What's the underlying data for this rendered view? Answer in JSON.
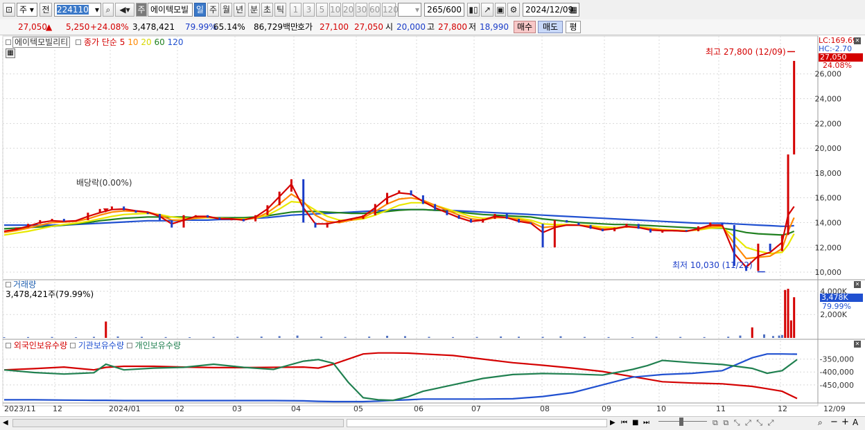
{
  "toolbar": {
    "market_select": "주",
    "prev_label": "전",
    "stock_code": "224110",
    "stock_name": "에이텍모빌",
    "code_badge": "주",
    "periods": [
      "일",
      "주",
      "월",
      "년",
      "분",
      "초",
      "틱"
    ],
    "selected_period": "일",
    "intervals": [
      "1",
      "3",
      "5",
      "10",
      "20",
      "30",
      "60",
      "120"
    ],
    "count_current": "265",
    "count_total": "/600",
    "date": "2024/12/09"
  },
  "info": {
    "price": "27,050",
    "up_arrow": "▲",
    "change": "5,250",
    "change_pct": "+24.08%",
    "volume": "3,478,421",
    "vol_ratio": "79.99%",
    "turnover": "65.14%",
    "amount": "86,729백만",
    "quote_label": "호가",
    "ask": "27,100",
    "bid": "27,050",
    "open_label": "시",
    "open": "20,000",
    "high_label": "고",
    "high": "27,800",
    "low_label": "저",
    "low": "18,990",
    "buy_label": "매수",
    "sell_label": "매도",
    "avg_label": "평"
  },
  "price_panel": {
    "legend_name": "에이텍모빌리티",
    "legend_ma_label": "종가 단순",
    "ma_periods": [
      "5",
      "10",
      "20",
      "60",
      "120"
    ],
    "ma_colors": [
      "#d40000",
      "#ff8800",
      "#e8e800",
      "#208020",
      "#2050d0"
    ],
    "lc_label": "LC:169.69",
    "hc_label": "HC:-2.70",
    "current_price_badge": "27,050",
    "pct_badge": "24.08%",
    "high_annotation": "최고 27,800 (12/09)",
    "low_annotation": "최저 10,030 (11/22)",
    "dividend_label": "배당락(0.00%)"
  },
  "volume_panel": {
    "title": "거래량",
    "value_label": "3,478,421주(79.99%)",
    "current_badge": "3,478K",
    "pct_badge": "79.99%"
  },
  "holdings_panel": {
    "legend": [
      {
        "name": "외국인보유수량",
        "color": "#d40000"
      },
      {
        "name": "기관보유수량",
        "color": "#2050d0"
      },
      {
        "name": "개인보유수량",
        "color": "#208050"
      }
    ]
  },
  "xaxis": {
    "labels": [
      "2023/11",
      "12",
      "2024/01",
      "02",
      "03",
      "04",
      "05",
      "06",
      "07",
      "08",
      "09",
      "10",
      "11",
      "12",
      "12/09"
    ]
  },
  "chart_data": [
    {
      "type": "line",
      "name": "price",
      "ylim": [
        9500,
        28500
      ],
      "y_ticks": [
        "10,000",
        "12,000",
        "14,000",
        "16,000",
        "18,000",
        "20,000",
        "22,000",
        "24,000",
        "26,000"
      ],
      "y_tick_values": [
        10000,
        12000,
        14000,
        16000,
        18000,
        20000,
        22000,
        24000,
        26000
      ],
      "x": [
        0,
        4,
        8,
        12,
        16,
        20,
        24,
        28,
        32,
        36,
        40,
        44,
        48,
        52,
        56,
        60,
        64,
        68,
        72,
        76,
        80,
        84,
        88,
        92,
        96,
        100,
        104,
        108,
        112,
        116,
        120,
        124,
        128,
        132,
        136,
        140,
        144,
        148,
        152,
        156,
        160,
        164,
        168,
        172,
        176,
        180,
        184,
        188,
        192,
        196,
        200,
        204,
        208,
        212,
        216,
        220,
        224,
        228,
        232,
        236,
        240,
        244,
        248,
        252,
        256,
        260,
        262,
        264
      ],
      "close": [
        13400,
        13600,
        13900,
        14200,
        14300,
        14100,
        14200,
        14800,
        15100,
        15300,
        15000,
        14800,
        14700,
        14200,
        13600,
        14600,
        14600,
        14400,
        14200,
        14300,
        14100,
        14600,
        15400,
        16500,
        17500,
        14000,
        13600,
        14000,
        14200,
        14300,
        14600,
        15500,
        16400,
        16600,
        16200,
        15500,
        15000,
        14600,
        14300,
        14000,
        14300,
        14700,
        14300,
        14000,
        13900,
        12000,
        14200,
        14000,
        13800,
        13500,
        13300,
        13600,
        13900,
        13500,
        13200,
        13300,
        13400,
        13300,
        13700,
        14000,
        13800,
        10500,
        10100,
        12300,
        11700,
        13000,
        19500,
        27050
      ],
      "ma5": [
        13300,
        13450,
        13700,
        14000,
        14150,
        14100,
        14150,
        14500,
        14800,
        15050,
        15100,
        14950,
        14850,
        14500,
        13900,
        14200,
        14500,
        14500,
        14300,
        14300,
        14200,
        14450,
        15100,
        16100,
        17100,
        15200,
        13900,
        13900,
        14100,
        14300,
        14500,
        15200,
        16000,
        16400,
        16300,
        15700,
        15200,
        14800,
        14400,
        14100,
        14200,
        14500,
        14400,
        14100,
        13950,
        13200,
        13600,
        13800,
        13800,
        13600,
        13400,
        13500,
        13700,
        13600,
        13400,
        13350,
        13350,
        13300,
        13500,
        13800,
        13800,
        11500,
        10400,
        11300,
        11600,
        12400,
        14600,
        15300
      ],
      "ma10": [
        13200,
        13350,
        13550,
        13800,
        14000,
        14050,
        14100,
        14300,
        14600,
        14850,
        14950,
        14900,
        14850,
        14600,
        14200,
        14200,
        14350,
        14450,
        14350,
        14300,
        14250,
        14350,
        14800,
        15500,
        16300,
        15700,
        14600,
        14100,
        14000,
        14200,
        14400,
        14900,
        15500,
        15900,
        16000,
        15800,
        15400,
        15000,
        14600,
        14300,
        14200,
        14400,
        14400,
        14250,
        14050,
        13600,
        13700,
        13800,
        13800,
        13700,
        13500,
        13500,
        13650,
        13600,
        13500,
        13400,
        13350,
        13300,
        13450,
        13650,
        13700,
        12300,
        11100,
        11200,
        11300,
        11900,
        13300,
        14400
      ],
      "ma20": [
        13000,
        13150,
        13300,
        13500,
        13700,
        13850,
        13950,
        14100,
        14300,
        14500,
        14650,
        14700,
        14750,
        14650,
        14450,
        14350,
        14350,
        14400,
        14350,
        14300,
        14300,
        14350,
        14600,
        15100,
        15700,
        15600,
        15000,
        14500,
        14200,
        14200,
        14300,
        14600,
        15000,
        15400,
        15600,
        15600,
        15400,
        15100,
        14800,
        14500,
        14350,
        14400,
        14400,
        14350,
        14200,
        13900,
        13850,
        13850,
        13800,
        13750,
        13650,
        13600,
        13650,
        13650,
        13550,
        13450,
        13400,
        13350,
        13400,
        13550,
        13600,
        12900,
        12000,
        11700,
        11500,
        11600,
        12200,
        13100
      ],
      "ma60": [
        13500,
        13550,
        13600,
        13650,
        13700,
        13800,
        13900,
        14000,
        14150,
        14250,
        14350,
        14400,
        14450,
        14450,
        14450,
        14450,
        14400,
        14400,
        14400,
        14400,
        14400,
        14450,
        14550,
        14700,
        14850,
        14900,
        14900,
        14850,
        14800,
        14750,
        14750,
        14800,
        14900,
        15000,
        15050,
        15050,
        15000,
        14950,
        14850,
        14750,
        14650,
        14600,
        14550,
        14500,
        14450,
        14300,
        14200,
        14100,
        14000,
        13950,
        13900,
        13850,
        13850,
        13800,
        13750,
        13700,
        13650,
        13600,
        13550,
        13550,
        13550,
        13400,
        13200,
        13100,
        13050,
        13000,
        13100,
        13300
      ],
      "ma120": [
        13800,
        13800,
        13800,
        13800,
        13800,
        13800,
        13850,
        13900,
        13950,
        14000,
        14050,
        14100,
        14150,
        14150,
        14150,
        14200,
        14200,
        14200,
        14250,
        14250,
        14300,
        14350,
        14400,
        14500,
        14600,
        14650,
        14700,
        14750,
        14800,
        14850,
        14900,
        14950,
        15000,
        15050,
        15050,
        15050,
        15000,
        15000,
        14950,
        14900,
        14850,
        14800,
        14750,
        14700,
        14650,
        14600,
        14550,
        14500,
        14450,
        14400,
        14350,
        14300,
        14250,
        14200,
        14150,
        14100,
        14050,
        14000,
        13950,
        13950,
        13950,
        13900,
        13850,
        13800,
        13750,
        13700,
        13700,
        13750
      ]
    },
    {
      "type": "bar",
      "name": "volume",
      "ylim": [
        0,
        4500000
      ],
      "y_ticks": [
        "2,000K",
        "4,000K"
      ],
      "y_tick_values": [
        2000000,
        4000000
      ],
      "bars": [
        [
          0,
          60000
        ],
        [
          8,
          70000
        ],
        [
          16,
          80000
        ],
        [
          24,
          60000
        ],
        [
          30,
          90000
        ],
        [
          34,
          1400000
        ],
        [
          38,
          120000
        ],
        [
          46,
          90000
        ],
        [
          54,
          70000
        ],
        [
          62,
          60000
        ],
        [
          70,
          80000
        ],
        [
          78,
          90000
        ],
        [
          86,
          110000
        ],
        [
          92,
          150000
        ],
        [
          98,
          200000
        ],
        [
          106,
          100000
        ],
        [
          114,
          80000
        ],
        [
          122,
          110000
        ],
        [
          128,
          180000
        ],
        [
          134,
          150000
        ],
        [
          142,
          90000
        ],
        [
          150,
          70000
        ],
        [
          158,
          80000
        ],
        [
          166,
          120000
        ],
        [
          172,
          100000
        ],
        [
          180,
          90000
        ],
        [
          186,
          140000
        ],
        [
          194,
          80000
        ],
        [
          202,
          70000
        ],
        [
          210,
          60000
        ],
        [
          218,
          90000
        ],
        [
          226,
          80000
        ],
        [
          234,
          70000
        ],
        [
          242,
          100000
        ],
        [
          246,
          200000
        ],
        [
          250,
          900000
        ],
        [
          254,
          300000
        ],
        [
          257,
          160000
        ],
        [
          259,
          200000
        ],
        [
          260,
          250000
        ],
        [
          261,
          4100000
        ],
        [
          262,
          4200000
        ],
        [
          263,
          1500000
        ],
        [
          264,
          3478421
        ]
      ]
    },
    {
      "type": "line",
      "name": "holdings",
      "ylim": [
        -515000,
        -300000
      ],
      "y_ticks": [
        "-350,000",
        "-400,000",
        "-450,000"
      ],
      "y_tick_values": [
        -350000,
        -400000,
        -450000
      ],
      "x": [
        0,
        10,
        20,
        30,
        34,
        40,
        50,
        60,
        70,
        80,
        90,
        100,
        105,
        110,
        115,
        120,
        125,
        130,
        135,
        140,
        150,
        160,
        170,
        180,
        190,
        200,
        210,
        215,
        220,
        230,
        240,
        250,
        255,
        260,
        265
      ],
      "foreign": [
        -392000,
        -387000,
        -381000,
        -392000,
        -382000,
        -378000,
        -378000,
        -381000,
        -383000,
        -383000,
        -382000,
        -381000,
        -385000,
        -370000,
        -350000,
        -330000,
        -326000,
        -326000,
        -327000,
        -330000,
        -336000,
        -350000,
        -364000,
        -374000,
        -385000,
        -398000,
        -418000,
        -428000,
        -438000,
        -443000,
        -446000,
        -456000,
        -465000,
        -475000,
        -503000
      ],
      "institution": [
        -508000,
        -508000,
        -509000,
        -510000,
        -510000,
        -511000,
        -511000,
        -511000,
        -511000,
        -511000,
        -511000,
        -512000,
        -514000,
        -515000,
        -515000,
        -515000,
        -513000,
        -510000,
        -508000,
        -505000,
        -505000,
        -505000,
        -504000,
        -495000,
        -480000,
        -450000,
        -420000,
        -415000,
        -410000,
        -405000,
        -395000,
        -345000,
        -330000,
        -330000,
        -331000
      ],
      "individual": [
        -392000,
        -402000,
        -408000,
        -403000,
        -370000,
        -392000,
        -385000,
        -382000,
        -370000,
        -382000,
        -390000,
        -358000,
        -352000,
        -366000,
        -440000,
        -500000,
        -508000,
        -510000,
        -496000,
        -475000,
        -450000,
        -425000,
        -410000,
        -406000,
        -408000,
        -412000,
        -390000,
        -375000,
        -355000,
        -364000,
        -371000,
        -386000,
        -405000,
        -395000,
        -352000
      ]
    }
  ]
}
